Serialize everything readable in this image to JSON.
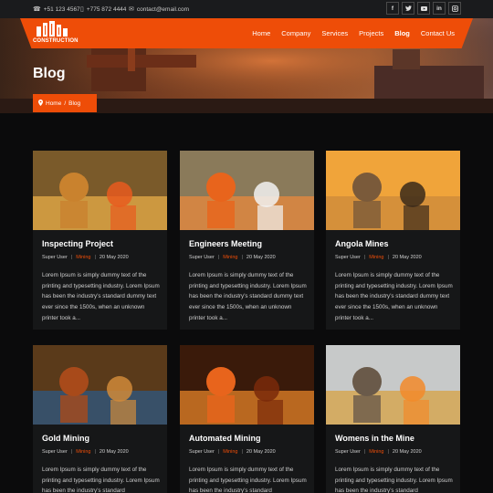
{
  "topbar": {
    "phone1": "+51 123 4567",
    "phone2": "+775 872 4444",
    "email": "contact@email.com",
    "socials": [
      "f",
      "t",
      "yt",
      "in",
      "ig"
    ]
  },
  "logo": {
    "text": "CONSTRUCTION"
  },
  "nav": [
    "Home",
    "Company",
    "Services",
    "Projects",
    "Blog",
    "Contact Us"
  ],
  "hero": {
    "title": "Blog",
    "breadcrumb_home": "Home",
    "breadcrumb_sep": "/",
    "breadcrumb_current": "Blog"
  },
  "posts": [
    {
      "title": "Inspecting Project",
      "author": "Super User",
      "category": "Mining",
      "date": "20 May 2020",
      "excerpt": "Lorem Ipsum is simply dummy text of the printing and typesetting industry. Lorem Ipsum has been the industry's standard dummy text ever since the 1500s, when an unknown printer took a..."
    },
    {
      "title": "Engineers Meeting",
      "author": "Super User",
      "category": "Mining",
      "date": "20 May 2020",
      "excerpt": "Lorem Ipsum is simply dummy text of the printing and typesetting industry. Lorem Ipsum has been the industry's standard dummy text ever since the 1500s, when an unknown printer took a..."
    },
    {
      "title": "Angola Mines",
      "author": "Super User",
      "category": "Mining",
      "date": "20 May 2020",
      "excerpt": "Lorem Ipsum is simply dummy text of the printing and typesetting industry. Lorem Ipsum has been the industry's standard dummy text ever since the 1500s, when an unknown printer took a..."
    },
    {
      "title": "Gold Mining",
      "author": "Super User",
      "category": "Mining",
      "date": "20 May 2020",
      "excerpt": "Lorem Ipsum is simply dummy text of the printing and typesetting industry. Lorem Ipsum has been the industry's standard"
    },
    {
      "title": "Automated Mining",
      "author": "Super User",
      "category": "Mining",
      "date": "20 May 2020",
      "excerpt": "Lorem Ipsum is simply dummy text of the printing and typesetting industry. Lorem Ipsum has been the industry's standard"
    },
    {
      "title": "Womens in the Mine",
      "author": "Super User",
      "category": "Mining",
      "date": "20 May 2020",
      "excerpt": "Lorem Ipsum is simply dummy text of the printing and typesetting industry. Lorem Ipsum has been the industry's standard"
    }
  ],
  "colors": {
    "accent": "#ee4d08",
    "bg": "#0b0b0c",
    "card": "#161718",
    "topbar": "#1a1b1d"
  }
}
